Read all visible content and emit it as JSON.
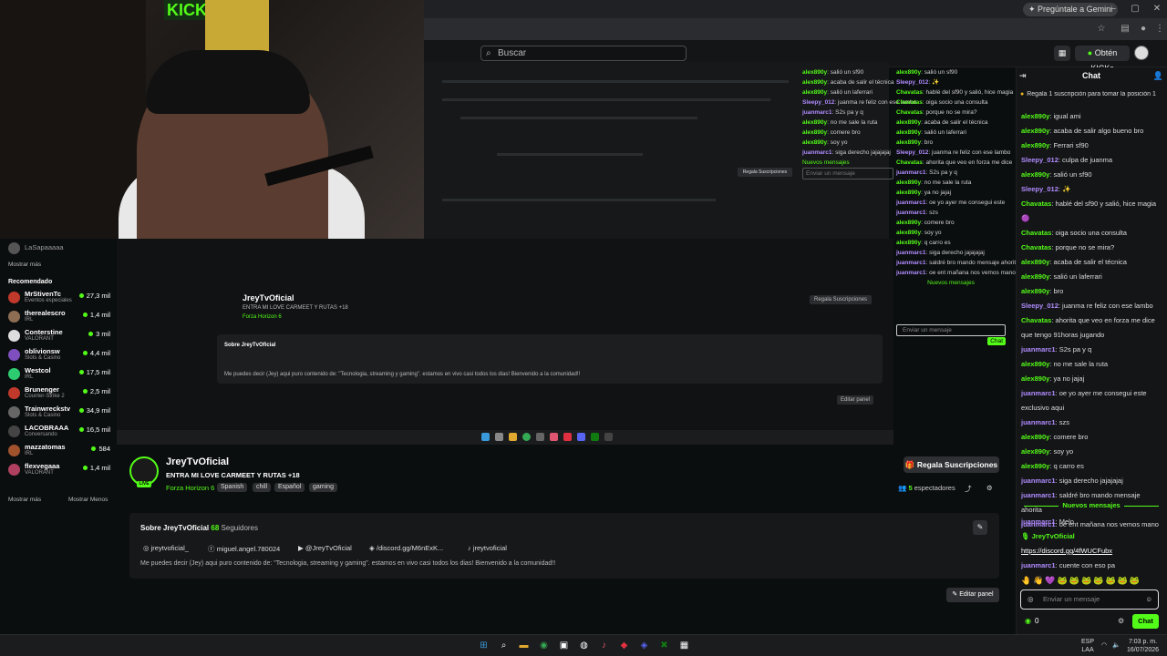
{
  "browser": {
    "gemini_label": "✦ Pregúntale a Gemini",
    "win_min": "–",
    "win_max": "▢",
    "win_close": "✕"
  },
  "header": {
    "search_placeholder": "Buscar",
    "get_kicks_label": "Obtén KICKs"
  },
  "webcam": {
    "sign_text": "KICK"
  },
  "sidebar": {
    "top_user": "LaSapaaaaa",
    "show_more_top": "Mostrar más",
    "recommended_heading": "Recomendado",
    "items": [
      {
        "name": "MrStivenTc",
        "category": "Eventos especiales",
        "viewers": "27,3 mil",
        "color": "#c0392b"
      },
      {
        "name": "therealescro",
        "category": "IRL",
        "viewers": "1,4 mil",
        "color": "#8e6e53"
      },
      {
        "name": "Conterstine",
        "category": "VALORANT",
        "viewers": "3 mil",
        "color": "#dddddd"
      },
      {
        "name": "oblivionsw",
        "category": "Slots & Casino",
        "viewers": "4,4 mil",
        "color": "#7f4fbf"
      },
      {
        "name": "Westcol",
        "category": "IRL",
        "viewers": "17,5 mil",
        "color": "#2ecc71"
      },
      {
        "name": "Brunenger",
        "category": "Counter-Strike 2",
        "viewers": "2,5 mil",
        "color": "#c0392b"
      },
      {
        "name": "Trainwreckstv",
        "category": "Slots & Casino",
        "viewers": "34,9 mil",
        "color": "#666666"
      },
      {
        "name": "LACOBRAAA",
        "category": "Conversando",
        "viewers": "16,5 mil",
        "color": "#444444"
      },
      {
        "name": "mazzatomas",
        "category": "IRL",
        "viewers": "584",
        "color": "#a0522d"
      },
      {
        "name": "flexvegaaa",
        "category": "VALORANT",
        "viewers": "1,4 mil",
        "color": "#b04060"
      }
    ],
    "show_more": "Mostrar más",
    "show_less": "Mostrar Menos"
  },
  "channel": {
    "name": "JreyTvOficial",
    "title": "ENTRA MI LOVE CARMEET Y RUTAS +18",
    "game": "Forza Horizon 6",
    "tags": [
      "Spanish",
      "chill",
      "Español",
      "gaming"
    ],
    "live_label": "LIVE",
    "subscribe_label": "Regala Suscripciones",
    "viewer_count": "5",
    "viewer_label": "espectadores",
    "about_label": "Sobre JreyTvOficial",
    "followers_count": "68",
    "followers_label": "Seguidores",
    "socials": [
      {
        "icon": "instagram-icon",
        "glyph": "◎",
        "text": "jreytvoficial_"
      },
      {
        "icon": "facebook-icon",
        "glyph": "ⓕ",
        "text": "miguel.angel.780024"
      },
      {
        "icon": "youtube-icon",
        "glyph": "▶",
        "text": "@JreyTvOficial"
      },
      {
        "icon": "discord-icon",
        "glyph": "◈",
        "text": "/discord.gg/M6nExK..."
      },
      {
        "icon": "tiktok-icon",
        "glyph": "♪",
        "text": "jreytvoficial"
      }
    ],
    "description": "Me puedes decir (Jey) aqui puro contenido de: \"Tecnologia, streaming y gaming\". estamos en vivo casi todos los dias! Bienvenido a la comunidad!!",
    "edit_panel_label": "Editar panel"
  },
  "chat": {
    "title": "Chat",
    "pinned": "Regala 1 suscripción para tomar la posición 1",
    "messages": [
      {
        "user": "alex890y",
        "color": "g",
        "text": "igual ami"
      },
      {
        "user": "alex890y",
        "color": "g",
        "text": "acaba de salir algo bueno bro"
      },
      {
        "user": "alex890y",
        "color": "g",
        "text": "Ferrari sf90"
      },
      {
        "user": "Sleepy_012",
        "color": "p",
        "text": "culpa de juanma"
      },
      {
        "user": "alex890y",
        "color": "g",
        "text": "salió un sf90"
      },
      {
        "user": "Sleepy_012",
        "color": "p",
        "text": "✨"
      },
      {
        "user": "Chavatas",
        "color": "g",
        "text": "hablé del sf90 y salió, hice magia"
      },
      {
        "user": "",
        "color": "g",
        "text": "🟣"
      },
      {
        "user": "Chavatas",
        "color": "g",
        "text": "oiga socio una consulta"
      },
      {
        "user": "Chavatas",
        "color": "g",
        "text": "porque no se mira?"
      },
      {
        "user": "alex890y",
        "color": "g",
        "text": "acaba de salir el técnica"
      },
      {
        "user": "alex890y",
        "color": "g",
        "text": "salió un laferrari"
      },
      {
        "user": "alex890y",
        "color": "g",
        "text": "bro"
      },
      {
        "user": "Sleepy_012",
        "color": "p",
        "text": "juanma re feliz con ese lambo"
      },
      {
        "user": "Chavatas",
        "color": "g",
        "text": "ahorita que veo en forza me dice que tengo 91horas jugando"
      },
      {
        "user": "juanmarc1",
        "color": "p",
        "text": "S2s pa y q"
      },
      {
        "user": "alex890y",
        "color": "g",
        "text": "no me sale la ruta"
      },
      {
        "user": "alex890y",
        "color": "g",
        "text": "ya no jajaj"
      },
      {
        "user": "juanmarc1",
        "color": "p",
        "text": "oe yo ayer me consegui este exclusivo aqui"
      },
      {
        "user": "juanmarc1",
        "color": "p",
        "text": "szs"
      },
      {
        "user": "alex890y",
        "color": "g",
        "text": "comere bro"
      },
      {
        "user": "alex890y",
        "color": "g",
        "text": "soy yo"
      },
      {
        "user": "alex890y",
        "color": "g",
        "text": "q carro es"
      },
      {
        "user": "juanmarc1",
        "color": "p",
        "text": "siga derecho jajajajaj"
      },
      {
        "user": "juanmarc1",
        "color": "p",
        "text": "saldré bro mando mensaje ahorita"
      },
      {
        "user": "juanmarc1",
        "color": "p",
        "text": "oe ent mañana nos vemos mano"
      }
    ],
    "new_messages_label": "Nuevos mensajes",
    "new_messages": [
      {
        "user": "juanmarc1",
        "color": "p",
        "text": "Melo"
      },
      {
        "user": "🎙 JreyTvOficial",
        "color": "g",
        "text": ""
      },
      {
        "user": "",
        "color": "g",
        "text": "https://discord.gg/4fWUCFubx"
      },
      {
        "user": "juanmarc1",
        "color": "p",
        "text": "cuente con eso pa"
      }
    ],
    "emotes": "🤚👋💜🐸🐸🐸🐸🐸🐸🐸",
    "input_placeholder": "Enviar un mensaje",
    "send_label": "Chat",
    "points": "0"
  },
  "nested_chat": {
    "lines": [
      {
        "user": "alex890y",
        "text": "salió un sf90"
      },
      {
        "user": "Sleepy_012",
        "text": "✨"
      },
      {
        "user": "Chavatas",
        "text": "hablé del sf90 y salió, hice magia"
      },
      {
        "user": "Chavatas",
        "text": "oiga socio una consulta"
      },
      {
        "user": "Chavatas",
        "text": "porque no se mira?"
      },
      {
        "user": "alex890y",
        "text": "acaba de salir el técnica"
      },
      {
        "user": "alex890y",
        "text": "salió un laferrari"
      },
      {
        "user": "alex890y",
        "text": "bro"
      },
      {
        "user": "Sleepy_012",
        "text": "juanma re feliz con ese lambo"
      },
      {
        "user": "Chavatas",
        "text": "ahorita que veo en forza me dice"
      },
      {
        "user": "juanmarc1",
        "text": "S2s pa y q"
      },
      {
        "user": "alex890y",
        "text": "no me sale la ruta"
      },
      {
        "user": "alex890y",
        "text": "ya no jajaj"
      },
      {
        "user": "juanmarc1",
        "text": "oe yo ayer me consegui este"
      },
      {
        "user": "juanmarc1",
        "text": "szs"
      },
      {
        "user": "alex890y",
        "text": "comere bro"
      },
      {
        "user": "alex890y",
        "text": "soy yo"
      },
      {
        "user": "alex890y",
        "text": "q carro es"
      },
      {
        "user": "juanmarc1",
        "text": "siga derecho jajajajaj"
      },
      {
        "user": "juanmarc1",
        "text": "saldré bro mando mensaje ahorita"
      },
      {
        "user": "juanmarc1",
        "text": "oe ent mañana nos vemos mano"
      }
    ],
    "new_label": "Nuevos mensajes",
    "input_placeholder": "Enviar un mensaje",
    "send_label": "Chat"
  },
  "taskbar": {
    "lang_top": "ESP",
    "lang_bottom": "LAA",
    "time": "7:03 p. m.",
    "date": "16/07/2026"
  }
}
